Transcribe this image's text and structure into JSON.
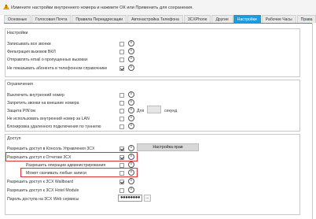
{
  "info_bar": {
    "text": "Измените настройки внутреннего номера и нажмите ОК или Применить для сохранения."
  },
  "tabs": [
    {
      "label": "Основные"
    },
    {
      "label": "Голосовая Почта"
    },
    {
      "label": "Правила Переадресации"
    },
    {
      "label": "Автонастройка Телефона"
    },
    {
      "label": "3CXPhone"
    },
    {
      "label": "Другие"
    },
    {
      "label": "Настройки"
    },
    {
      "label": "Рабочие Часы"
    },
    {
      "label": "Права"
    }
  ],
  "active_tab": "Настройки",
  "sections": {
    "settings": {
      "title": "Настройки",
      "rows": [
        {
          "label": "Записывать все звонки",
          "checked": false
        },
        {
          "label": "Фильтрация вызовов ВКЛ",
          "checked": false
        },
        {
          "label": "Отправлять email о пропущенных вызовах",
          "checked": false
        },
        {
          "label": "Не показывать абонента в телефонном справочнике",
          "checked": true
        }
      ]
    },
    "restrictions": {
      "title": "Ограничения",
      "rows": [
        {
          "label": "Выключить внутренний номер",
          "checked": false
        },
        {
          "label": "Запретить звонки на внешние номера",
          "checked": false
        },
        {
          "label": "Защита PIN'ом",
          "checked": false
        },
        {
          "label": "Не использовать внутренний номер за LAN",
          "checked": false
        },
        {
          "label": "Блокировка удаленного подключения по туннелю",
          "checked": false
        }
      ],
      "pin_for_label": "Для",
      "pin_seconds_label": "секунд"
    },
    "access": {
      "title": "Доступ",
      "rows": [
        {
          "label": "Разрешить доступ в Консоль Управления 3CX",
          "checked": true
        },
        {
          "label": "Разрешить доступ к Отчетам 3CX",
          "checked": true
        },
        {
          "label": "Разрешить операции администрирования",
          "checked": false
        },
        {
          "label": "Может скачивать любые записи",
          "checked": false
        },
        {
          "label": "Разрешить доступ к 3CX Wallboard",
          "checked": true
        },
        {
          "label": "Разрешить доступ к 3CX Hotel Module",
          "checked": false
        },
        {
          "label": "Пароль доступа на 3CX Web сервисы",
          "checked": false
        }
      ],
      "rights_button": "Настройка прав",
      "password_value": "●●●●●●●●",
      "dots_button": "..."
    }
  },
  "colors": {
    "accent": "#1e9be0",
    "highlight": "#d93333",
    "warning": "#f0a000"
  },
  "icons": {
    "info": "info-circle-icon",
    "warning": "warning-icon"
  }
}
